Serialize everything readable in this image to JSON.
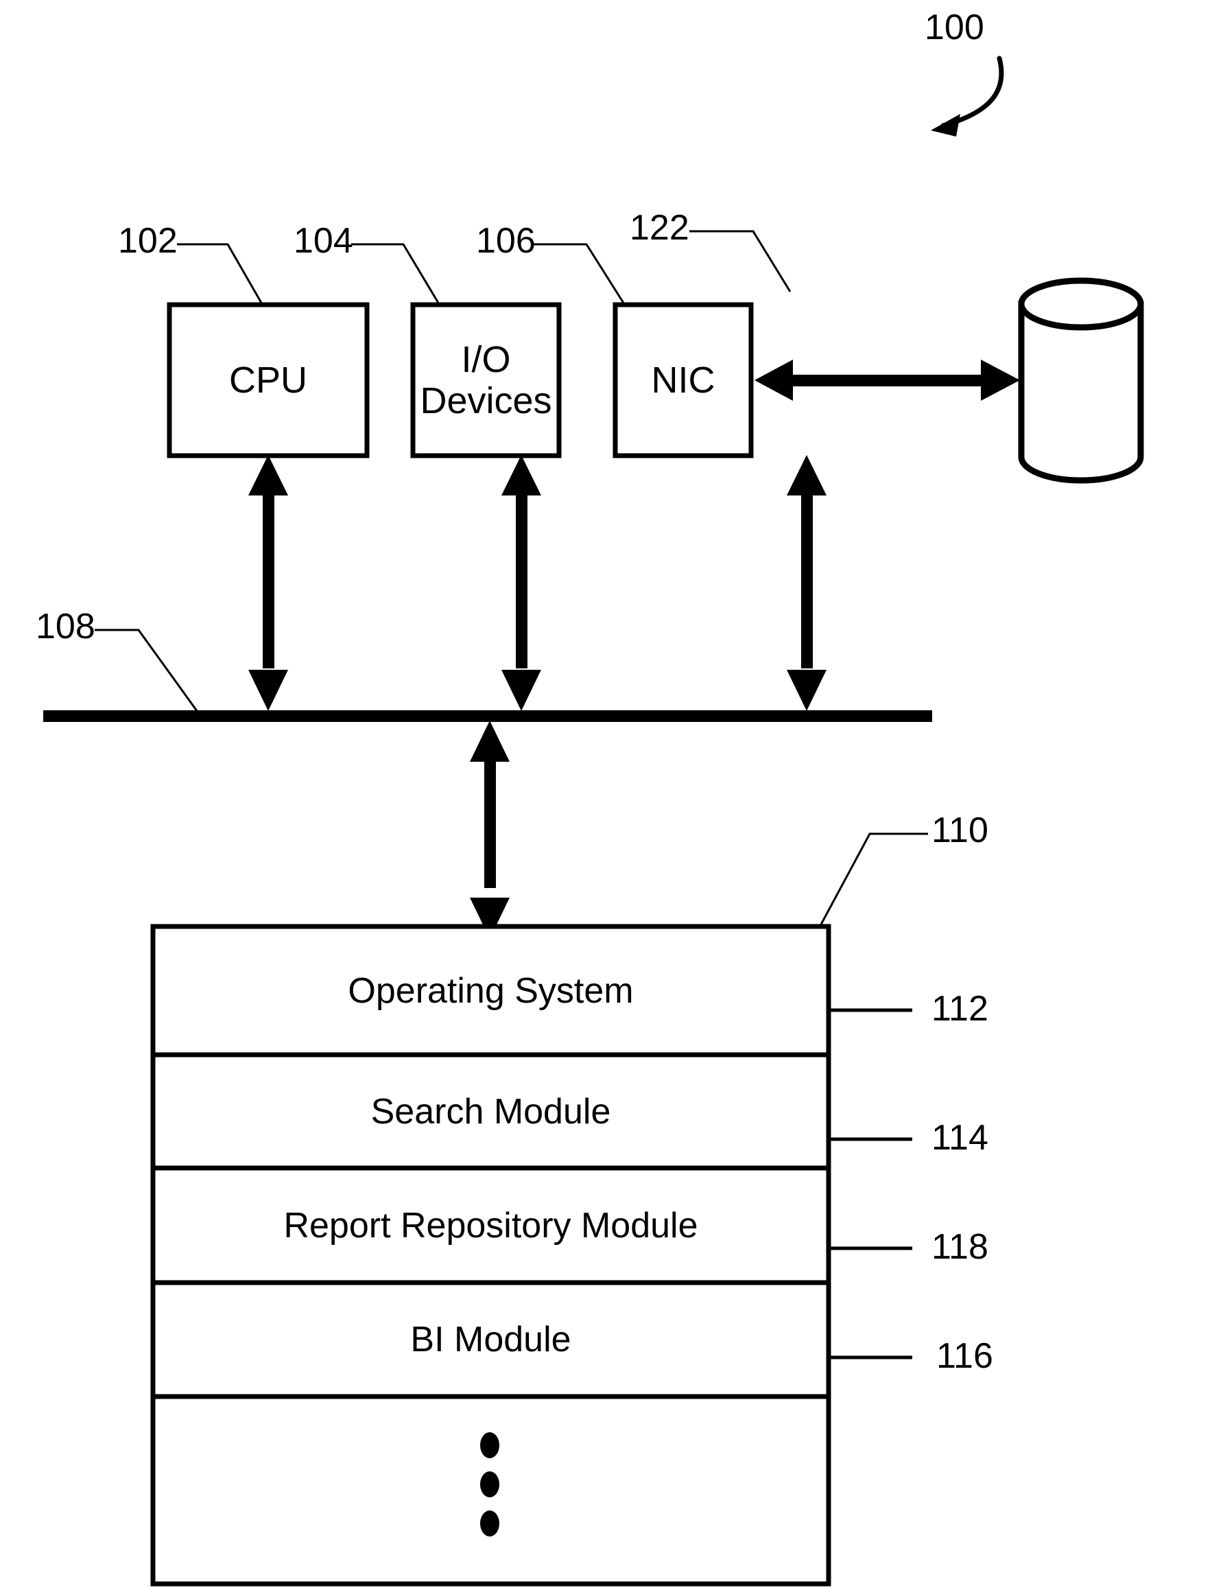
{
  "figure": {
    "figure_ref": "100",
    "components": [
      {
        "ref": "102",
        "label": "CPU"
      },
      {
        "ref": "104",
        "label": "I/O\nDevices"
      },
      {
        "ref": "106",
        "label": "NIC"
      },
      {
        "ref": "122",
        "label": ""
      },
      {
        "ref": "108",
        "label": ""
      },
      {
        "ref": "110",
        "label": ""
      }
    ],
    "hardware_boxes": [
      {
        "ref": "102",
        "name": "cpu",
        "label": "CPU"
      },
      {
        "ref": "104",
        "name": "io-devices",
        "label_line1": "I/O",
        "label_line2": "Devices"
      },
      {
        "ref": "106",
        "name": "nic",
        "label": "NIC"
      }
    ],
    "storage": {
      "ref": "122",
      "shape": "cylinder",
      "label": ""
    },
    "bus": {
      "ref": "108",
      "label": ""
    },
    "memory": {
      "ref": "110",
      "rows": [
        {
          "ref": "112",
          "label": "Operating System"
        },
        {
          "ref": "114",
          "label": "Search Module"
        },
        {
          "ref": "118",
          "label": "Report Repository Module"
        },
        {
          "ref": "116",
          "label": "BI Module"
        },
        {
          "ref": "",
          "label": "",
          "glyph": "vertical-ellipsis"
        }
      ]
    },
    "colors": {
      "ink": "#000000",
      "paper": "#ffffff"
    }
  }
}
